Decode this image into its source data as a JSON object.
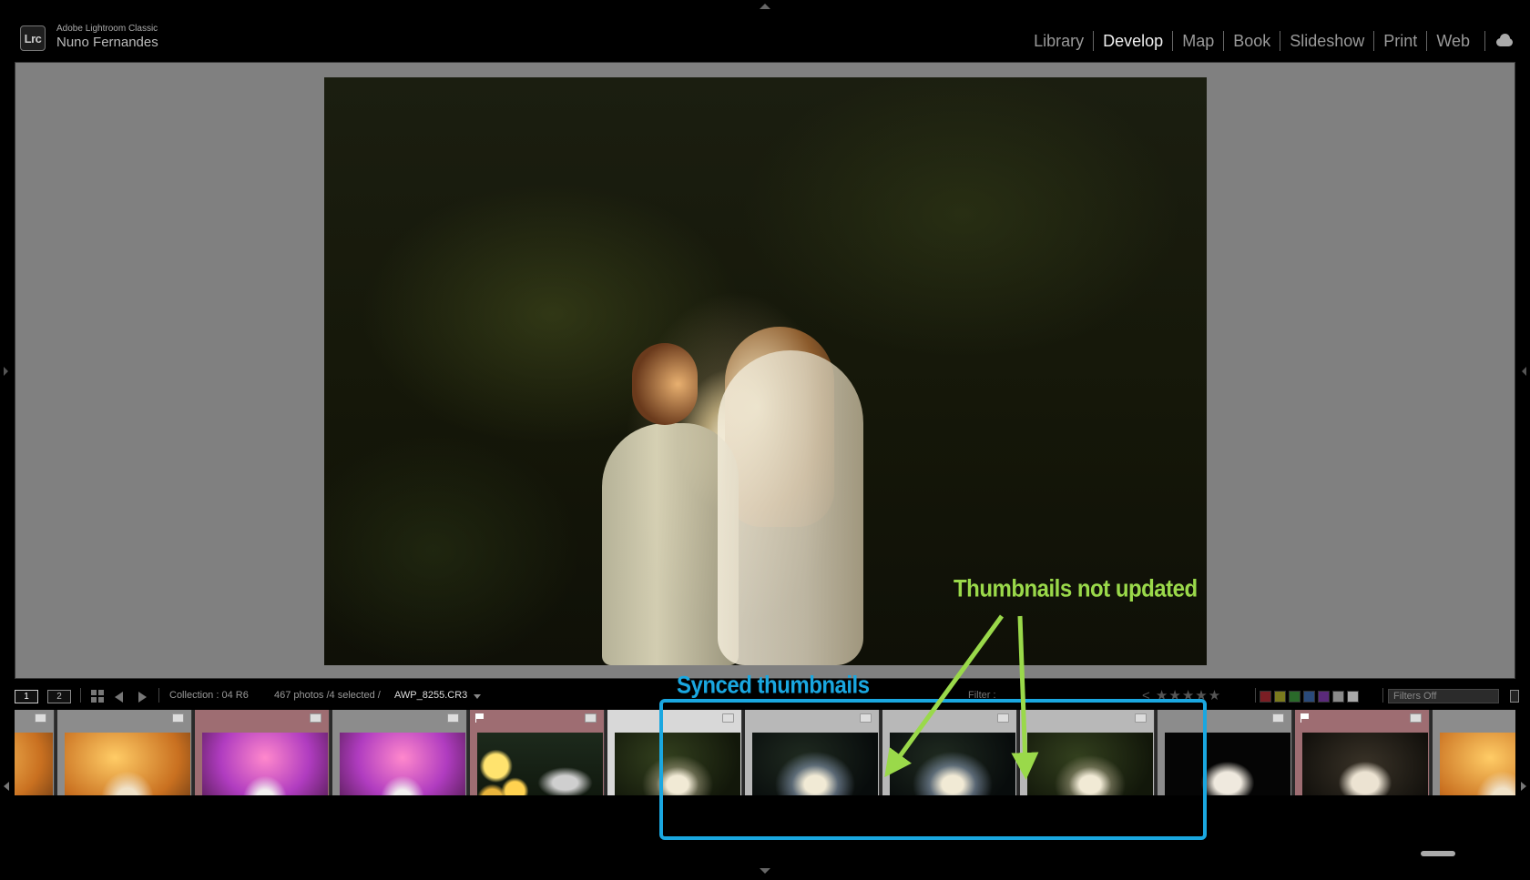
{
  "app": {
    "logo": "Lrc",
    "product": "Adobe Lightroom Classic",
    "user": "Nuno Fernandes"
  },
  "modules": [
    {
      "label": "Library",
      "active": false
    },
    {
      "label": "Develop",
      "active": true
    },
    {
      "label": "Map",
      "active": false
    },
    {
      "label": "Book",
      "active": false
    },
    {
      "label": "Slideshow",
      "active": false
    },
    {
      "label": "Print",
      "active": false
    },
    {
      "label": "Web",
      "active": false
    }
  ],
  "icons": {
    "cloud": "cloud-icon",
    "grid": "grid-icon",
    "back": "arrow-left-icon",
    "forward": "arrow-right-icon"
  },
  "filmstrip_toolbar": {
    "screen1": "1",
    "screen2": "2",
    "collection": "Collection : 04 R6",
    "count": "467 photos /4 selected /",
    "filename": "AWP_8255.CR3",
    "filter_label": "Filter :",
    "stars": "< ★★★★★",
    "filters_dropdown": "Filters Off",
    "color_labels": [
      "#7a1e24",
      "#7a7a1e",
      "#2a6a2a",
      "#2a4a7a",
      "#5a2a7a",
      "#8a8a8a",
      "#aaaaaa"
    ]
  },
  "filmstrip": {
    "cells": [
      {
        "style": "th-warm",
        "bg": "#8c8c8c",
        "flag": false,
        "rating": ""
      },
      {
        "style": "th-warm",
        "bg": "#8c8c8c",
        "flag": false,
        "rating": ""
      },
      {
        "style": "th-purple",
        "bg": "#9e6d72",
        "flag": false,
        "rating": "★★★★★"
      },
      {
        "style": "th-purple",
        "bg": "#8c8c8c",
        "flag": false,
        "rating": ""
      },
      {
        "style": "th-bokeh",
        "bg": "#9e6d72",
        "flag": true,
        "rating": "★★★★★"
      },
      {
        "style": "th-night",
        "bg": "#d8d8d8",
        "flag": false,
        "rating": ""
      },
      {
        "style": "th-night-blue",
        "bg": "#b8b8b8",
        "flag": false,
        "rating": ""
      },
      {
        "style": "th-night-blue",
        "bg": "#b8b8b8",
        "flag": false,
        "rating": ""
      },
      {
        "style": "th-night",
        "bg": "#b8b8b8",
        "flag": false,
        "rating": ""
      },
      {
        "style": "th-studio",
        "bg": "#8c8c8c",
        "flag": false,
        "rating": ""
      },
      {
        "style": "th-studio2",
        "bg": "#9e6d72",
        "flag": true,
        "rating": "★★★★★"
      },
      {
        "style": "th-warm",
        "bg": "#8c8c8c",
        "flag": false,
        "rating": ""
      }
    ]
  },
  "annotations": {
    "synced": "Synced thumbnails",
    "not_updated": "Thumbnails not updated",
    "box_color": "#1aa7e0",
    "arrow_color": "#9ad94a"
  }
}
